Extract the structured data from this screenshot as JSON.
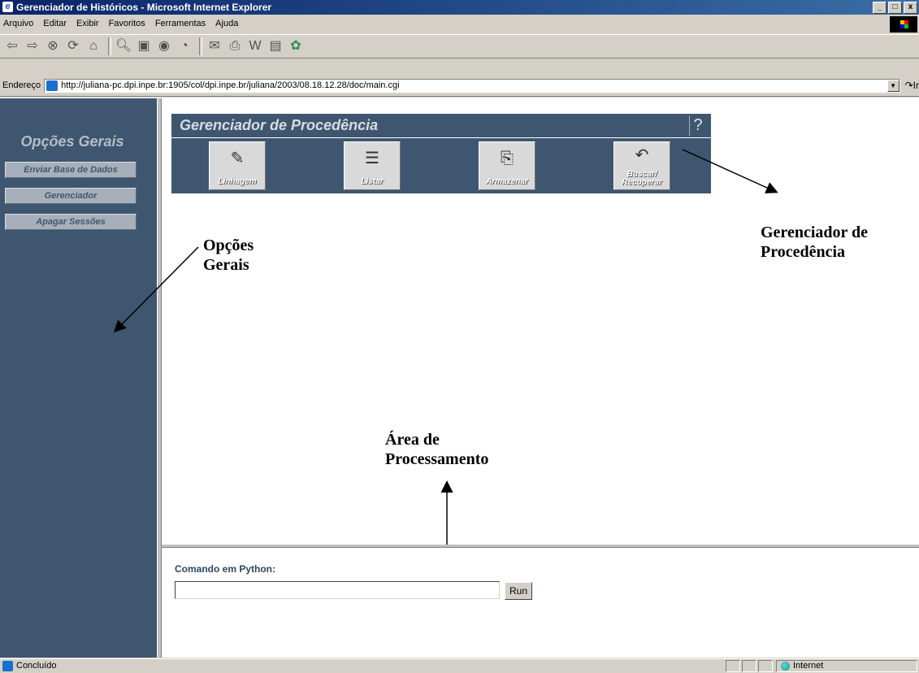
{
  "window": {
    "title": "Gerenciador de Históricos - Microsoft Internet Explorer",
    "buttons": [
      "_",
      "□",
      "x"
    ]
  },
  "menu": [
    "Arquivo",
    "Editar",
    "Exibir",
    "Favoritos",
    "Ferramentas",
    "Ajuda"
  ],
  "address": {
    "label": "Endereço",
    "url": "http://juliana-pc.dpi.inpe.br:1905/col/dpi.inpe.br/juliana/2003/08.18.12.28/doc/main.cgi",
    "go_label": "Ir"
  },
  "left": {
    "heading": "Opções Gerais",
    "buttons": [
      "Enviar Base de Dados",
      "Gerenciador",
      "Apagar Sessões"
    ]
  },
  "panel": {
    "title": "Gerenciador de Procedência",
    "help": "?",
    "buttons": [
      "Linhagem",
      "Listar",
      "Armazenar",
      "Buscar/\nRecuperar"
    ]
  },
  "annotations": {
    "opcoes": "Opções\nGerais",
    "gerenciador": "Gerenciador de\nProcedência",
    "area": "Área de\nProcessamento"
  },
  "command": {
    "label": "Comando em Python:",
    "value": "",
    "run": "Run"
  },
  "status": {
    "text": "Concluído",
    "zone": "Internet"
  }
}
